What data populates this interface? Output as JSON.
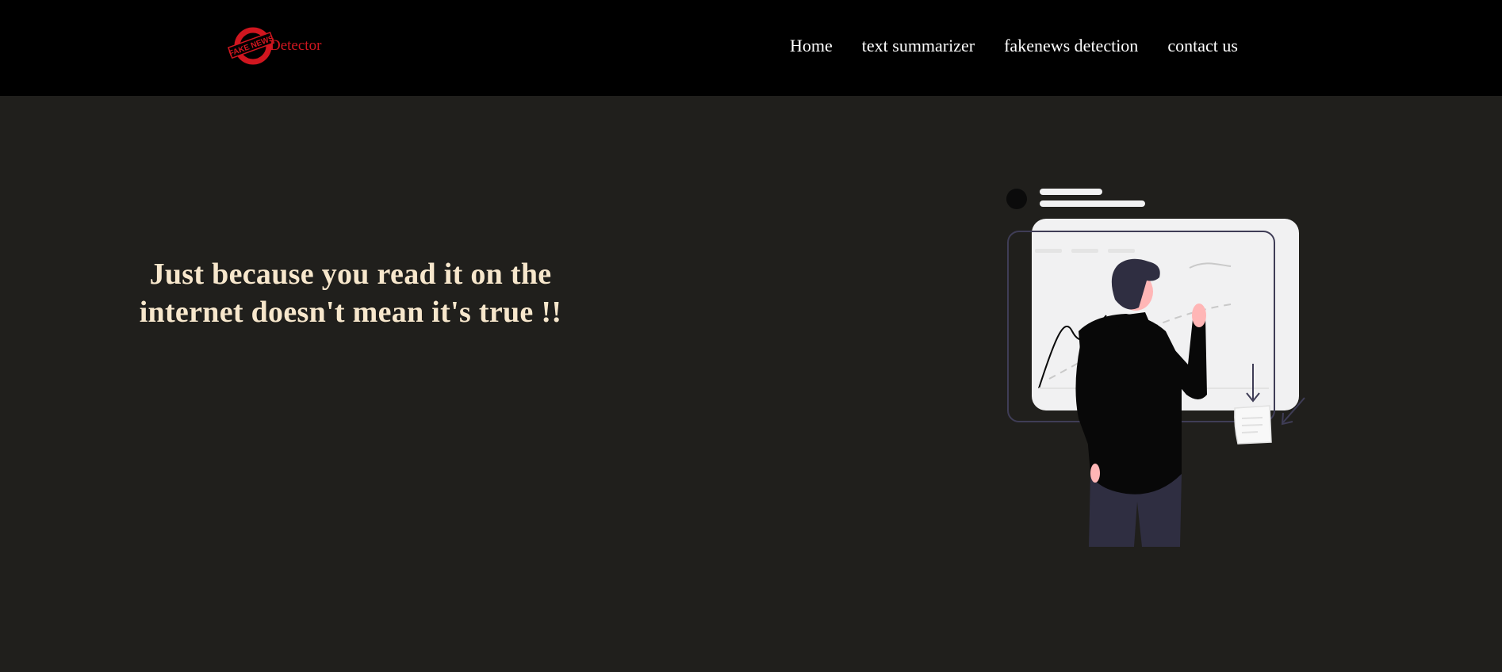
{
  "navbar": {
    "logo": {
      "stamp_text": "FAKE NEWS",
      "wordmark": "Detector"
    },
    "links": [
      {
        "label": "Home"
      },
      {
        "label": "text summarizer"
      },
      {
        "label": "fakenews detection"
      },
      {
        "label": "contact us"
      }
    ]
  },
  "hero": {
    "headline_line1": "Just because you read it on the",
    "headline_line2": "internet doesn't mean it's true !!",
    "illustration_icon": "person-at-whiteboard-chart-illustration"
  },
  "colors": {
    "navbar_bg": "#000000",
    "page_bg": "#201f1c",
    "logo_red": "#d0161f",
    "nav_text": "#ffffff",
    "headline": "#f7e7cc",
    "illustration_dark": "#2f2e41",
    "illustration_light": "#f1f1f2",
    "skin": "#ffb6b6"
  }
}
